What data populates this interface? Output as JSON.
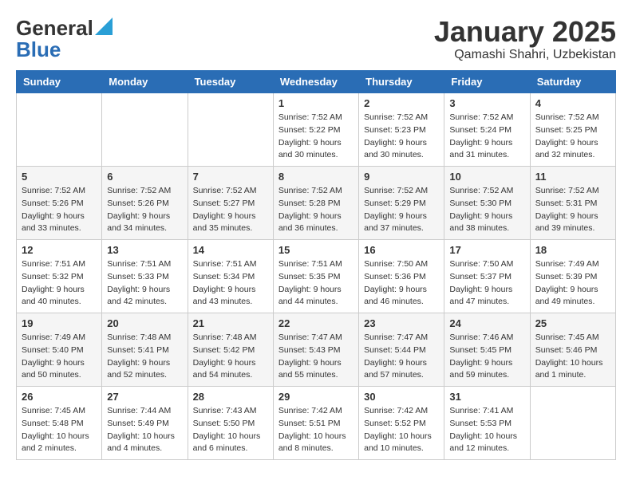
{
  "header": {
    "logo_line1": "General",
    "logo_line2": "Blue",
    "month": "January 2025",
    "location": "Qamashi Shahri, Uzbekistan"
  },
  "weekdays": [
    "Sunday",
    "Monday",
    "Tuesday",
    "Wednesday",
    "Thursday",
    "Friday",
    "Saturday"
  ],
  "weeks": [
    [
      {
        "day": "",
        "sunrise": "",
        "sunset": "",
        "daylight": ""
      },
      {
        "day": "",
        "sunrise": "",
        "sunset": "",
        "daylight": ""
      },
      {
        "day": "",
        "sunrise": "",
        "sunset": "",
        "daylight": ""
      },
      {
        "day": "1",
        "sunrise": "7:52 AM",
        "sunset": "5:22 PM",
        "daylight": "9 hours and 30 minutes."
      },
      {
        "day": "2",
        "sunrise": "7:52 AM",
        "sunset": "5:23 PM",
        "daylight": "9 hours and 30 minutes."
      },
      {
        "day": "3",
        "sunrise": "7:52 AM",
        "sunset": "5:24 PM",
        "daylight": "9 hours and 31 minutes."
      },
      {
        "day": "4",
        "sunrise": "7:52 AM",
        "sunset": "5:25 PM",
        "daylight": "9 hours and 32 minutes."
      }
    ],
    [
      {
        "day": "5",
        "sunrise": "7:52 AM",
        "sunset": "5:26 PM",
        "daylight": "9 hours and 33 minutes."
      },
      {
        "day": "6",
        "sunrise": "7:52 AM",
        "sunset": "5:26 PM",
        "daylight": "9 hours and 34 minutes."
      },
      {
        "day": "7",
        "sunrise": "7:52 AM",
        "sunset": "5:27 PM",
        "daylight": "9 hours and 35 minutes."
      },
      {
        "day": "8",
        "sunrise": "7:52 AM",
        "sunset": "5:28 PM",
        "daylight": "9 hours and 36 minutes."
      },
      {
        "day": "9",
        "sunrise": "7:52 AM",
        "sunset": "5:29 PM",
        "daylight": "9 hours and 37 minutes."
      },
      {
        "day": "10",
        "sunrise": "7:52 AM",
        "sunset": "5:30 PM",
        "daylight": "9 hours and 38 minutes."
      },
      {
        "day": "11",
        "sunrise": "7:52 AM",
        "sunset": "5:31 PM",
        "daylight": "9 hours and 39 minutes."
      }
    ],
    [
      {
        "day": "12",
        "sunrise": "7:51 AM",
        "sunset": "5:32 PM",
        "daylight": "9 hours and 40 minutes."
      },
      {
        "day": "13",
        "sunrise": "7:51 AM",
        "sunset": "5:33 PM",
        "daylight": "9 hours and 42 minutes."
      },
      {
        "day": "14",
        "sunrise": "7:51 AM",
        "sunset": "5:34 PM",
        "daylight": "9 hours and 43 minutes."
      },
      {
        "day": "15",
        "sunrise": "7:51 AM",
        "sunset": "5:35 PM",
        "daylight": "9 hours and 44 minutes."
      },
      {
        "day": "16",
        "sunrise": "7:50 AM",
        "sunset": "5:36 PM",
        "daylight": "9 hours and 46 minutes."
      },
      {
        "day": "17",
        "sunrise": "7:50 AM",
        "sunset": "5:37 PM",
        "daylight": "9 hours and 47 minutes."
      },
      {
        "day": "18",
        "sunrise": "7:49 AM",
        "sunset": "5:39 PM",
        "daylight": "9 hours and 49 minutes."
      }
    ],
    [
      {
        "day": "19",
        "sunrise": "7:49 AM",
        "sunset": "5:40 PM",
        "daylight": "9 hours and 50 minutes."
      },
      {
        "day": "20",
        "sunrise": "7:48 AM",
        "sunset": "5:41 PM",
        "daylight": "9 hours and 52 minutes."
      },
      {
        "day": "21",
        "sunrise": "7:48 AM",
        "sunset": "5:42 PM",
        "daylight": "9 hours and 54 minutes."
      },
      {
        "day": "22",
        "sunrise": "7:47 AM",
        "sunset": "5:43 PM",
        "daylight": "9 hours and 55 minutes."
      },
      {
        "day": "23",
        "sunrise": "7:47 AM",
        "sunset": "5:44 PM",
        "daylight": "9 hours and 57 minutes."
      },
      {
        "day": "24",
        "sunrise": "7:46 AM",
        "sunset": "5:45 PM",
        "daylight": "9 hours and 59 minutes."
      },
      {
        "day": "25",
        "sunrise": "7:45 AM",
        "sunset": "5:46 PM",
        "daylight": "10 hours and 1 minute."
      }
    ],
    [
      {
        "day": "26",
        "sunrise": "7:45 AM",
        "sunset": "5:48 PM",
        "daylight": "10 hours and 2 minutes."
      },
      {
        "day": "27",
        "sunrise": "7:44 AM",
        "sunset": "5:49 PM",
        "daylight": "10 hours and 4 minutes."
      },
      {
        "day": "28",
        "sunrise": "7:43 AM",
        "sunset": "5:50 PM",
        "daylight": "10 hours and 6 minutes."
      },
      {
        "day": "29",
        "sunrise": "7:42 AM",
        "sunset": "5:51 PM",
        "daylight": "10 hours and 8 minutes."
      },
      {
        "day": "30",
        "sunrise": "7:42 AM",
        "sunset": "5:52 PM",
        "daylight": "10 hours and 10 minutes."
      },
      {
        "day": "31",
        "sunrise": "7:41 AM",
        "sunset": "5:53 PM",
        "daylight": "10 hours and 12 minutes."
      },
      {
        "day": "",
        "sunrise": "",
        "sunset": "",
        "daylight": ""
      }
    ]
  ]
}
